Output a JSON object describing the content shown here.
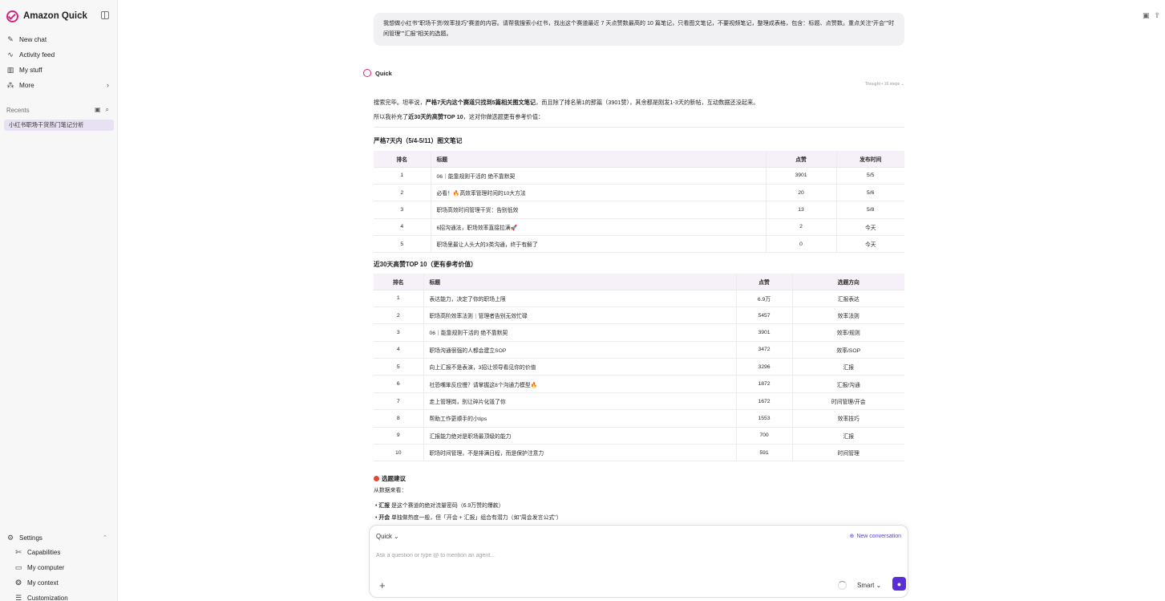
{
  "sidebar": {
    "brand": "Amazon Quick",
    "nav": [
      {
        "label": "New chat",
        "icon": "edit-icon"
      },
      {
        "label": "Activity feed",
        "icon": "pulse-icon"
      },
      {
        "label": "My stuff",
        "icon": "chart-icon"
      },
      {
        "label": "More",
        "icon": "apps-icon"
      }
    ],
    "recents_label": "Recents",
    "recent_item": "小红书职场干货热门笔记分析",
    "settings": "Settings",
    "sub_items": [
      {
        "label": "Capabilities",
        "icon": "wrench-icon"
      },
      {
        "label": "My computer",
        "icon": "monitor-icon"
      },
      {
        "label": "My context",
        "icon": "context-icon"
      },
      {
        "label": "Customization",
        "icon": "sliders-icon"
      }
    ]
  },
  "conversation": {
    "user_message": "我想做小红书\"职场干货/效率技巧\"赛道的内容。请帮我搜索小红书，找出这个赛道最近 7 天点赞数最高的 10 篇笔记，只看图文笔记，不要视频笔记，整理成表格，包含：标题、点赞数。重点关注\"开会\"\"时间管理\"\"汇报\"相关的选题。",
    "assistant_name": "Quick",
    "thought": "Thought • 16 steps ⌄",
    "para1_pre": "搜索完毕。坦率说，",
    "para1_bold": "严格7天内这个赛道只找到5篇相关图文笔记",
    "para1_post": "，而且除了排名第1的那篇（3901赞），其余都是刚发1-3天的新帖，互动数据还没起来。",
    "para2_pre": "所以我补充了",
    "para2_bold": "近30天的高赞TOP 10",
    "para2_post": "，这对你做选题更有参考价值：",
    "table1_title": "严格7天内（5/4-5/11）图文笔记",
    "table1_headers": [
      "排名",
      "标题",
      "点赞",
      "发布时间"
    ],
    "table1_rows": [
      [
        "1",
        "06｜能靠规则干活的 绝不靠默契",
        "3901",
        "5/5"
      ],
      [
        "2",
        "必看！🔥高效率管理时间的10大方法",
        "20",
        "5/6"
      ],
      [
        "3",
        "职场高效时间管理干货：告别低效",
        "13",
        "5/8"
      ],
      [
        "4",
        "6招沟通法，职场效率直接拉满🚀",
        "2",
        "今天"
      ],
      [
        "5",
        "职场里最让人头大的3类沟通，终于有解了",
        "0",
        "今天"
      ]
    ],
    "table2_title": "近30天高赞TOP 10（更有参考价值）",
    "table2_headers": [
      "排名",
      "标题",
      "点赞",
      "选题方向"
    ],
    "table2_rows": [
      [
        "1",
        "表达能力，决定了你的职场上限",
        "6.9万",
        "汇报表达"
      ],
      [
        "2",
        "职场高阶效率法则｜管理者告别无效忙碌",
        "5457",
        "效率法则"
      ],
      [
        "3",
        "06｜能靠规则干活的 绝不靠默契",
        "3901",
        "效率/规则"
      ],
      [
        "4",
        "职场沟通很强的人都会建立SOP",
        "3472",
        "效率/SOP"
      ],
      [
        "5",
        "向上汇报不是表演，3招让领导看见你的价值",
        "3296",
        "汇报"
      ],
      [
        "6",
        "社恐嘴笨反应慢？请掌握这8个沟通力模型🔥",
        "1872",
        "汇报/沟通"
      ],
      [
        "7",
        "走上管理岗，别让碎片化毁了你",
        "1672",
        "时间管理/开会"
      ],
      [
        "8",
        "帮助工作更顺手的小tips",
        "1553",
        "效率技巧"
      ],
      [
        "9",
        "汇报能力绝对是职场最顶级的能力",
        "700",
        "汇报"
      ],
      [
        "10",
        "职场时间管理，不是排满日程，而是保护注意力",
        "591",
        "时间管理"
      ]
    ],
    "suggest_title": "选题建议",
    "suggest_intro": "从数据来看：",
    "bullet1_bold": "汇报",
    "bullet1_text": " 是这个赛道的绝对流量密码（6.9万赞的爆款）",
    "bullet2_bold": "开会",
    "bullet2_text": " 单独做热度一般，但「开会 + 汇报」组合有潜力（如\"周会发言公式\"）"
  },
  "composer": {
    "agent": "Quick ⌄",
    "new_conversation": "New conversation",
    "placeholder": "Ask a question or type @ to mention an agent...",
    "mode": "Smart ⌄"
  }
}
